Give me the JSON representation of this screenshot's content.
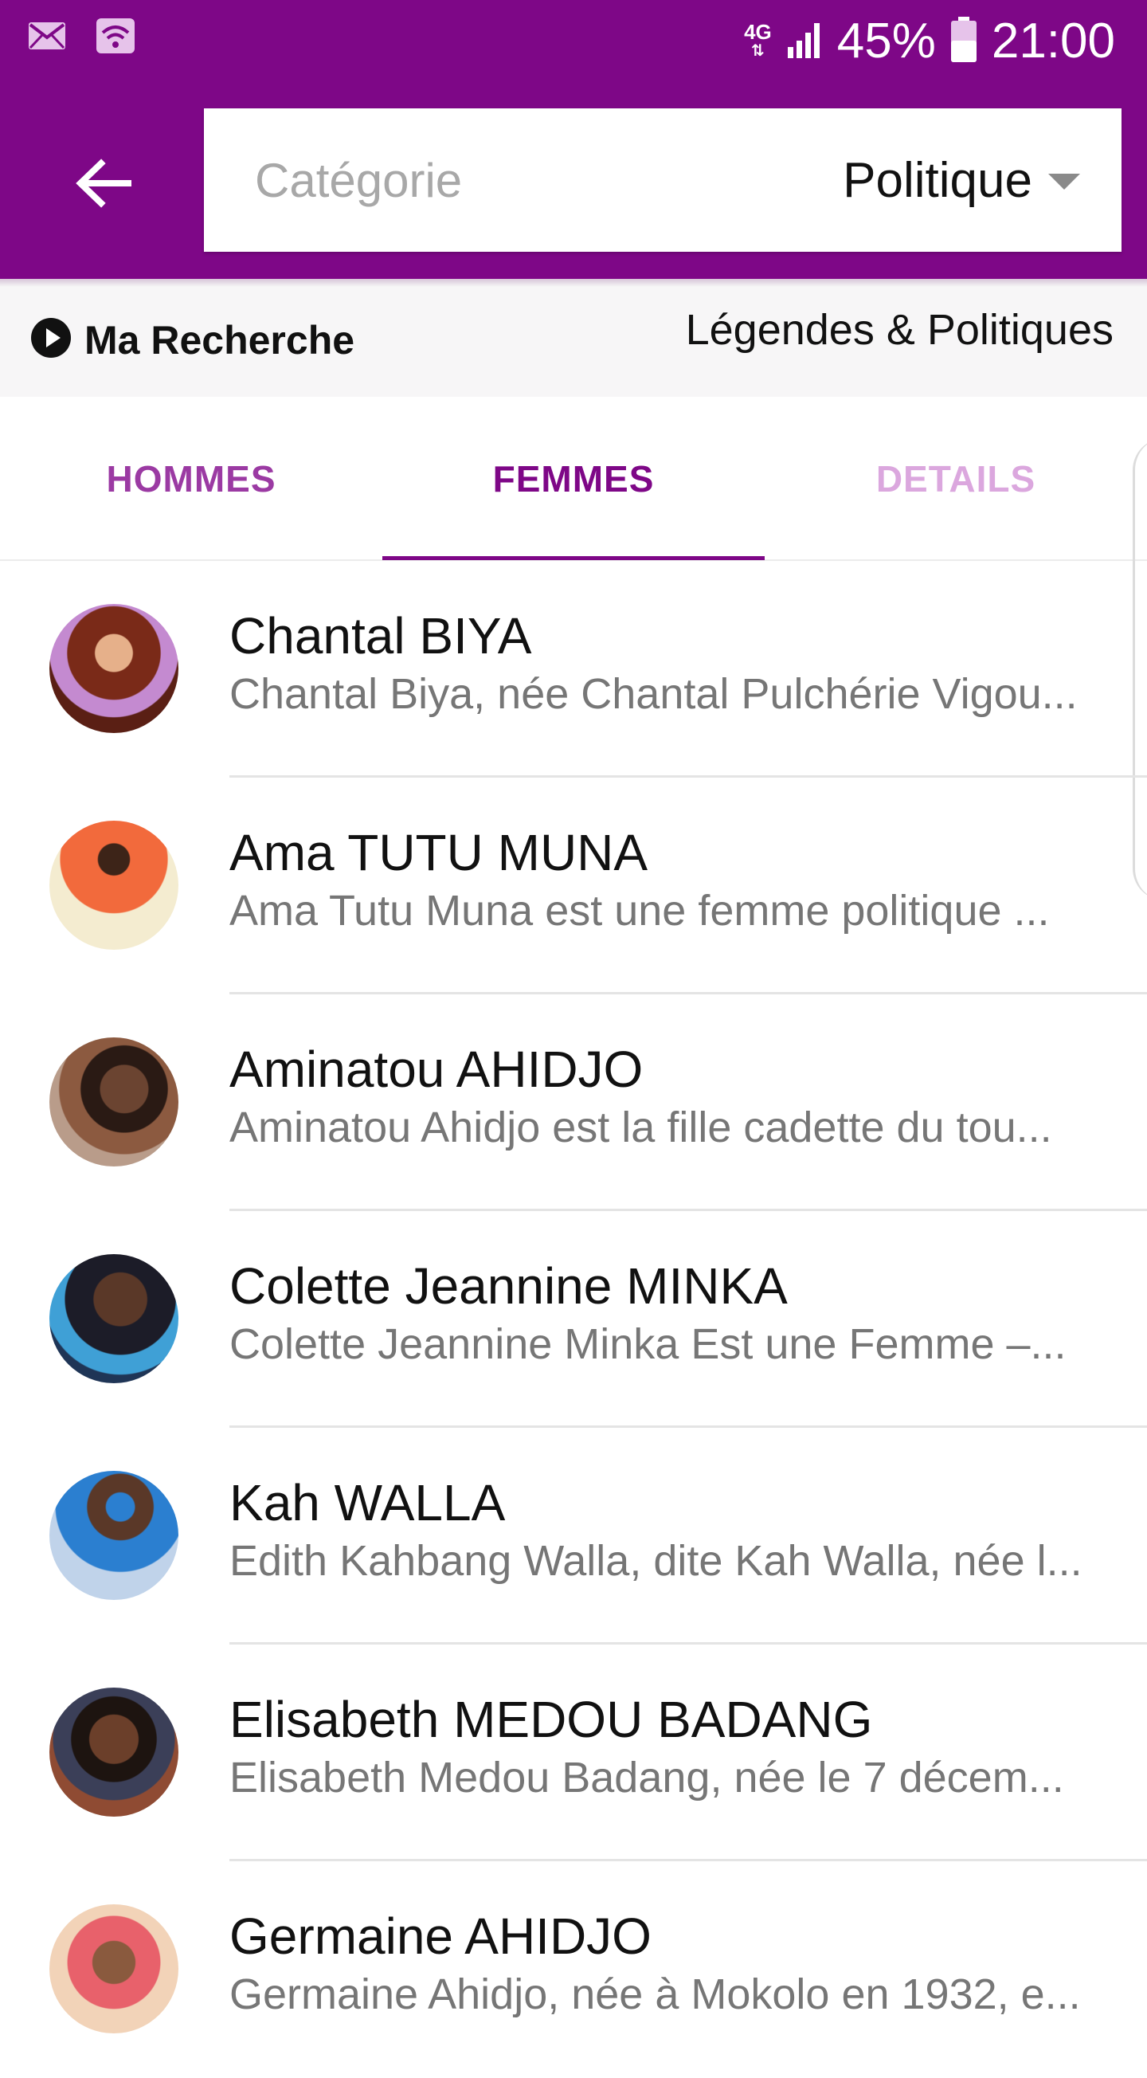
{
  "status_bar": {
    "network_type": "4G",
    "battery_percent": "45%",
    "time": "21:00",
    "left_icons": [
      "mail-icon",
      "wifi-icon"
    ],
    "right_icons": [
      "signal-icon",
      "battery-icon"
    ]
  },
  "app_bar": {
    "back_icon": "arrow-left-icon",
    "search_placeholder": "Catégorie",
    "selected_category": "Politique",
    "color": "#7e0787"
  },
  "info_bar": {
    "my_search_label": "Ma Recherche",
    "section_title": "Légendes & Politiques"
  },
  "tabs": [
    {
      "label": "HOMMES",
      "active": false
    },
    {
      "label": "FEMMES",
      "active": true
    },
    {
      "label": "DETAILS",
      "active": false
    }
  ],
  "people": [
    {
      "name": "Chantal BIYA",
      "summary": "Chantal Biya, née Chantal Pulchérie Vigou...",
      "avatar": "avatar-portrait"
    },
    {
      "name": "Ama TUTU MUNA",
      "summary": "Ama Tutu Muna est une femme politique ...",
      "avatar": "avatar-portrait"
    },
    {
      "name": "Aminatou AHIDJO",
      "summary": "Aminatou Ahidjo est la fille cadette du tou...",
      "avatar": "avatar-portrait"
    },
    {
      "name": "Colette Jeannine MINKA",
      "summary": "Colette Jeannine Minka Est une Femme –...",
      "avatar": "avatar-portrait"
    },
    {
      "name": "Kah WALLA",
      "summary": "Edith Kahbang Walla, dite Kah Walla, née l...",
      "avatar": "avatar-portrait"
    },
    {
      "name": "Elisabeth MEDOU BADANG",
      "summary": "Elisabeth Medou Badang, née le 7 décem...",
      "avatar": "avatar-portrait"
    },
    {
      "name": "Germaine AHIDJO",
      "summary": "Germaine Ahidjo, née à Mokolo en 1932, e...",
      "avatar": "avatar-portrait"
    }
  ]
}
